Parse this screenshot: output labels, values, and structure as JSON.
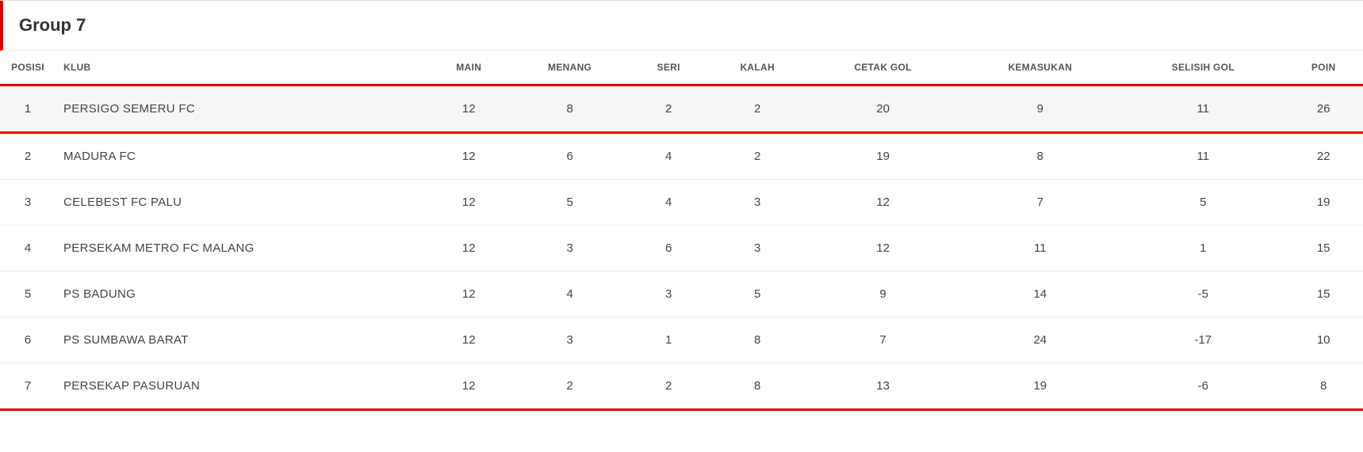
{
  "group_title": "Group 7",
  "columns": {
    "pos": "POSISI",
    "club": "KLUB",
    "main": "MAIN",
    "menang": "MENANG",
    "seri": "SERI",
    "kalah": "KALAH",
    "cetak_gol": "CETAK GOL",
    "kemasukan": "KEMASUKAN",
    "selisih_gol": "SELISIH GOL",
    "poin": "POIN"
  },
  "rows": [
    {
      "pos": "1",
      "club": "PERSIGO SEMERU FC",
      "main": "12",
      "menang": "8",
      "seri": "2",
      "kalah": "2",
      "cetak_gol": "20",
      "kemasukan": "9",
      "selisih_gol": "11",
      "poin": "26",
      "highlight": true
    },
    {
      "pos": "2",
      "club": "MADURA FC",
      "main": "12",
      "menang": "6",
      "seri": "4",
      "kalah": "2",
      "cetak_gol": "19",
      "kemasukan": "8",
      "selisih_gol": "11",
      "poin": "22",
      "highlight": false
    },
    {
      "pos": "3",
      "club": "CELEBEST FC PALU",
      "main": "12",
      "menang": "5",
      "seri": "4",
      "kalah": "3",
      "cetak_gol": "12",
      "kemasukan": "7",
      "selisih_gol": "5",
      "poin": "19",
      "highlight": false
    },
    {
      "pos": "4",
      "club": "PERSEKAM METRO FC MALANG",
      "main": "12",
      "menang": "3",
      "seri": "6",
      "kalah": "3",
      "cetak_gol": "12",
      "kemasukan": "11",
      "selisih_gol": "1",
      "poin": "15",
      "highlight": false
    },
    {
      "pos": "5",
      "club": "PS BADUNG",
      "main": "12",
      "menang": "4",
      "seri": "3",
      "kalah": "5",
      "cetak_gol": "9",
      "kemasukan": "14",
      "selisih_gol": "-5",
      "poin": "15",
      "highlight": false
    },
    {
      "pos": "6",
      "club": "PS SUMBAWA BARAT",
      "main": "12",
      "menang": "3",
      "seri": "1",
      "kalah": "8",
      "cetak_gol": "7",
      "kemasukan": "24",
      "selisih_gol": "-17",
      "poin": "10",
      "highlight": false
    },
    {
      "pos": "7",
      "club": "PERSEKAP PASURUAN",
      "main": "12",
      "menang": "2",
      "seri": "2",
      "kalah": "8",
      "cetak_gol": "13",
      "kemasukan": "19",
      "selisih_gol": "-6",
      "poin": "8",
      "highlight": false
    }
  ]
}
